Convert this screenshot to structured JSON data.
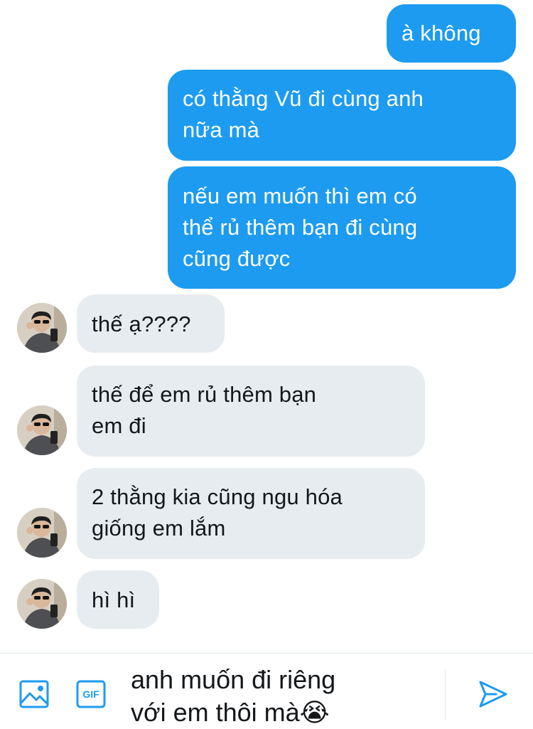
{
  "messages": [
    {
      "side": "sent",
      "lines": [
        "à không"
      ]
    },
    {
      "side": "sent",
      "lines": [
        "có thằng Vũ đi cùng anh",
        "nữa mà"
      ]
    },
    {
      "side": "sent",
      "lines": [
        "nếu em muốn thì em có",
        "thể rủ thêm bạn đi cùng",
        "cũng được"
      ]
    },
    {
      "side": "received",
      "lines": [
        "thế ạ????"
      ]
    },
    {
      "side": "received",
      "lines": [
        "thế để em rủ thêm bạn",
        "em đi"
      ]
    },
    {
      "side": "received",
      "lines": [
        "2 thằng kia cũng ngu hóa",
        "giống em lắm"
      ]
    },
    {
      "side": "received",
      "lines": [
        "hì hì"
      ]
    }
  ],
  "composer": {
    "lines": [
      "anh muốn đi riêng",
      "với em thôi mà😭"
    ],
    "icons": {
      "image": "image-icon",
      "gif": "gif-icon",
      "gif_label": "GIF",
      "send": "send-icon"
    }
  },
  "colors": {
    "sent_bubble": "#1d9bf0",
    "received_bubble": "#e7ecf0",
    "accent": "#1d9bf0",
    "text": "#14171a"
  }
}
